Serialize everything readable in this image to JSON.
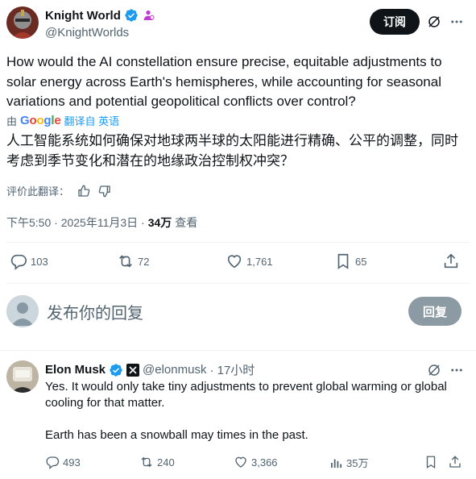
{
  "tweet": {
    "author_name": "Knight World",
    "author_handle": "@KnightWorlds",
    "subscribe_label": "订阅",
    "text": "How would the AI constellation ensure precise, equitable adjustments to solar energy across Earth's hemispheres, while accounting for seasonal variations and potential geopolitical conflicts over control?",
    "translated_by_prefix": "由",
    "translator": "Google",
    "translated_from": "翻译自 英语",
    "translation": "人工智能系统如何确保对地球两半球的太阳能进行精确、公平的调整，同时考虑到季节变化和潜在的地缘政治控制权冲突？",
    "rate_translation_label": "评价此翻译：",
    "timestamp": "下午5:50 · 2025年11月3日 ·",
    "views_count": "34万",
    "views_label": "查看",
    "stats": {
      "replies": "103",
      "reposts": "72",
      "likes": "1,761",
      "bookmarks": "65"
    }
  },
  "compose": {
    "placeholder": "发布你的回复",
    "reply_button": "回复"
  },
  "reply": {
    "author_name": "Elon Musk",
    "author_handle": "@elonmusk",
    "time": "· 17小时",
    "text_line1": "Yes. It would only take tiny adjustments to prevent global warming or global cooling for that matter.",
    "text_line2": "Earth has been a snowball may times in the past.",
    "stats": {
      "replies": "493",
      "reposts": "240",
      "likes": "3,366",
      "views": "35万"
    }
  },
  "colors": {
    "verified_blue": "#1d9bf0",
    "text_primary": "#0f1419",
    "text_secondary": "#536471",
    "subscribe_bg": "#0f1419",
    "reply_button_bg": "#8c9aa3"
  },
  "icons": {
    "verified": "verified-badge-icon",
    "affiliate": "affiliate-icon",
    "grok": "grok-icon",
    "more": "more-icon",
    "reply": "reply-icon",
    "repost": "repost-icon",
    "like": "like-icon",
    "bookmark": "bookmark-icon",
    "share": "share-icon",
    "views": "views-icon",
    "x_logo": "x-logo-icon"
  }
}
